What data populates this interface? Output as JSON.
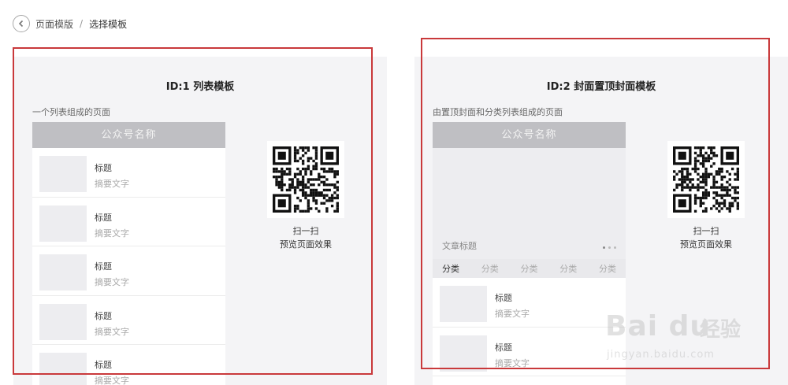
{
  "breadcrumb": {
    "parent": "页面模版",
    "separator": "/",
    "current": "选择模板"
  },
  "templates": [
    {
      "title": "ID:1 列表模板",
      "description": "一个列表组成的页面",
      "phone_header": "公众号名称",
      "items": [
        {
          "title": "标题",
          "summary": "摘要文字"
        },
        {
          "title": "标题",
          "summary": "摘要文字"
        },
        {
          "title": "标题",
          "summary": "摘要文字"
        },
        {
          "title": "标题",
          "summary": "摘要文字"
        },
        {
          "title": "标题",
          "summary": "摘要文字"
        }
      ],
      "qr_caption_line1": "扫一扫",
      "qr_caption_line2": "预览页面效果"
    },
    {
      "title": "ID:2 封面置顶封面模板",
      "description": "由置顶封面和分类列表组成的页面",
      "phone_header": "公众号名称",
      "cover_title": "文章标题",
      "tabs": [
        "分类",
        "分类",
        "分类",
        "分类",
        "分类"
      ],
      "items": [
        {
          "title": "标题",
          "summary": "摘要文字"
        },
        {
          "title": "标题",
          "summary": "摘要文字"
        }
      ],
      "qr_caption_line1": "扫一扫",
      "qr_caption_line2": "预览页面效果"
    }
  ],
  "watermark": {
    "brand": "Bai du",
    "brand_cn": "经验",
    "url": "jingyan.baidu.com"
  },
  "colors": {
    "highlight": "#c9393b",
    "card_bg": "#f4f4f6",
    "phone_header_bg": "#bfbfc3"
  }
}
